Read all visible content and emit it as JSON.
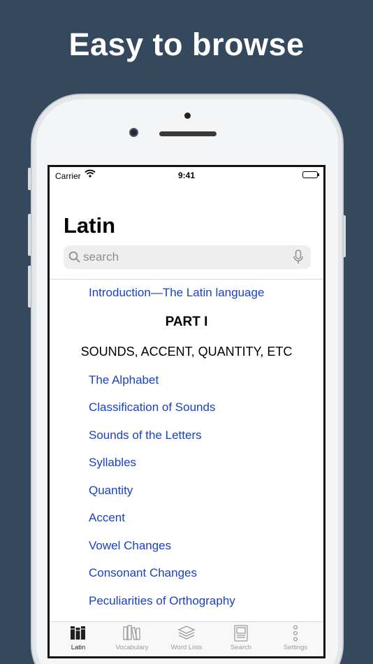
{
  "headline": "Easy to browse",
  "status": {
    "carrier": "Carrier",
    "time": "9:41"
  },
  "nav": {
    "title": "Latin"
  },
  "search": {
    "placeholder": "search",
    "value": ""
  },
  "toc": [
    {
      "type": "link",
      "label": "Introduction—The Latin language"
    },
    {
      "type": "part",
      "label": "PART I"
    },
    {
      "type": "section",
      "label": "SOUNDS, ACCENT, QUANTITY, ETC"
    },
    {
      "type": "link",
      "label": "The Alphabet"
    },
    {
      "type": "link",
      "label": "Classification of Sounds"
    },
    {
      "type": "link",
      "label": "Sounds of the Letters"
    },
    {
      "type": "link",
      "label": "Syllables"
    },
    {
      "type": "link",
      "label": "Quantity"
    },
    {
      "type": "link",
      "label": "Accent"
    },
    {
      "type": "link",
      "label": "Vowel Changes"
    },
    {
      "type": "link",
      "label": "Consonant Changes"
    },
    {
      "type": "link",
      "label": "Peculiarities of Orthography"
    }
  ],
  "tabs": [
    {
      "label": "Latin",
      "icon": "books-icon",
      "active": true
    },
    {
      "label": "Vocabulary",
      "icon": "library-icon",
      "active": false
    },
    {
      "label": "Word Lists",
      "icon": "stack-icon",
      "active": false
    },
    {
      "label": "Search",
      "icon": "book-search-icon",
      "active": false
    },
    {
      "label": "Settings",
      "icon": "more-dots-icon",
      "active": false
    }
  ],
  "colors": {
    "background": "#34495e",
    "link": "#1941c6",
    "tab_active": "#1f1f1f",
    "tab_inactive": "#9b9b9b"
  }
}
